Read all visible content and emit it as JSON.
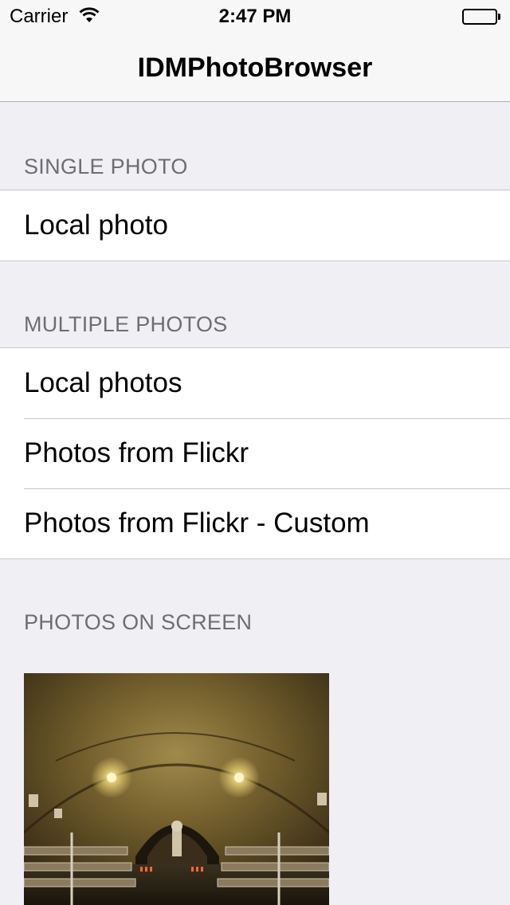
{
  "status_bar": {
    "carrier": "Carrier",
    "time": "2:47 PM",
    "icons": [
      "wifi-icon",
      "battery-icon"
    ]
  },
  "nav_bar": {
    "title": "IDMPhotoBrowser"
  },
  "sections": [
    {
      "header": "SINGLE PHOTO",
      "rows": [
        "Local photo"
      ]
    },
    {
      "header": "MULTIPLE PHOTOS",
      "rows": [
        "Local photos",
        "Photos from Flickr",
        "Photos from Flickr - Custom"
      ]
    },
    {
      "header": "PHOTOS ON SCREEN",
      "rows": []
    }
  ],
  "photo": {
    "description_name": "photo-thumbnail",
    "colors": {
      "vault": "#5a4a22",
      "vault_light": "#a08a4a",
      "lamp": "#fff6c8",
      "bench": "#8a7a5e",
      "candles": "#ff6a2a"
    }
  },
  "colors": {
    "background": "#efeff4",
    "bar": "#f7f7f7",
    "separator": "#c8c7cc",
    "header_text": "#6d6d72"
  }
}
